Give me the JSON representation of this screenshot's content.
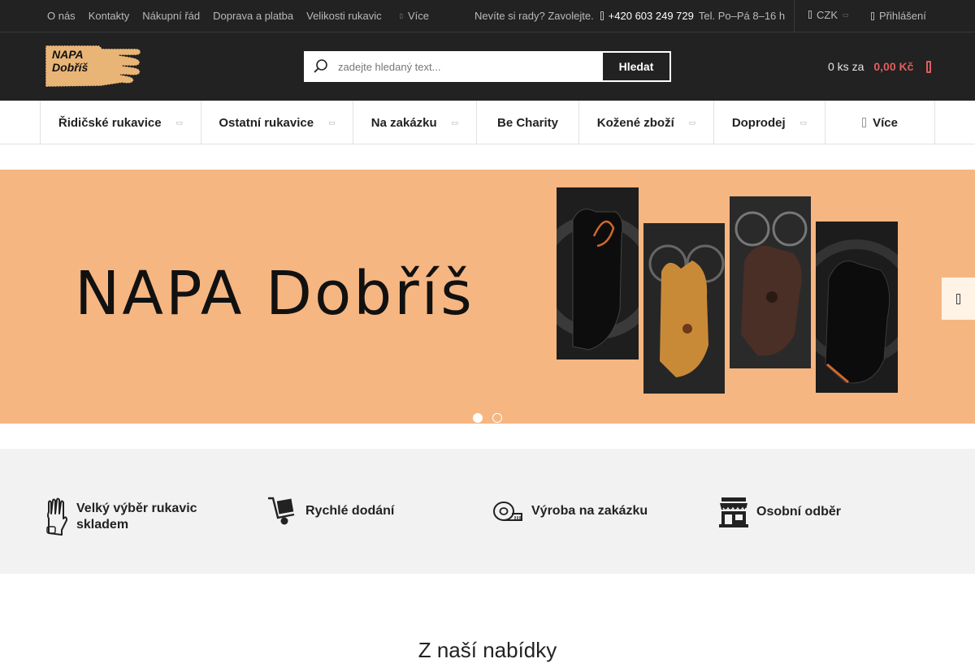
{
  "topbar": {
    "links": [
      "O nás",
      "Kontakty",
      "Nákupní řád",
      "Doprava a platba",
      "Velikosti rukavic"
    ],
    "more_label": "Více",
    "contact_text": "Nevíte si rady? Zavolejte.",
    "phone": "+420 603 249 729",
    "hours": "Tel. Po–Pá 8–16 h",
    "currency": "CZK",
    "login_label": "Přihlášení"
  },
  "header": {
    "logo_line1": "NAPA",
    "logo_line2": "Dobříš",
    "search_placeholder": "zadejte hledaný text...",
    "search_button": "Hledat",
    "cart_count": "0 ks za",
    "cart_price": "0,00 Kč"
  },
  "nav": {
    "items": [
      {
        "label": "Řidičské rukavice",
        "has_submenu": true
      },
      {
        "label": "Ostatní rukavice",
        "has_submenu": true
      },
      {
        "label": "Na zakázku",
        "has_submenu": true
      },
      {
        "label": "Be Charity",
        "has_submenu": false
      },
      {
        "label": "Kožené zboží",
        "has_submenu": true
      },
      {
        "label": "Doprodej",
        "has_submenu": true
      }
    ],
    "more_label": "Více"
  },
  "banner": {
    "title": "NAPA Dobříš",
    "background_color": "#f6b681",
    "slides": 2,
    "active_slide": 1
  },
  "benefits": [
    {
      "icon": "glove-icon",
      "label": "Velký výběr rukavic skladem"
    },
    {
      "icon": "hand-truck-icon",
      "label": "Rychlé dodání"
    },
    {
      "icon": "measuring-tape-icon",
      "label": "Výroba na zakázku"
    },
    {
      "icon": "store-icon",
      "label": "Osobní odběr"
    }
  ],
  "section": {
    "title": "Z naší nabídky"
  },
  "colors": {
    "dark": "#222222",
    "accent_price": "#e15d5d",
    "logo_tan": "#e9b576"
  }
}
